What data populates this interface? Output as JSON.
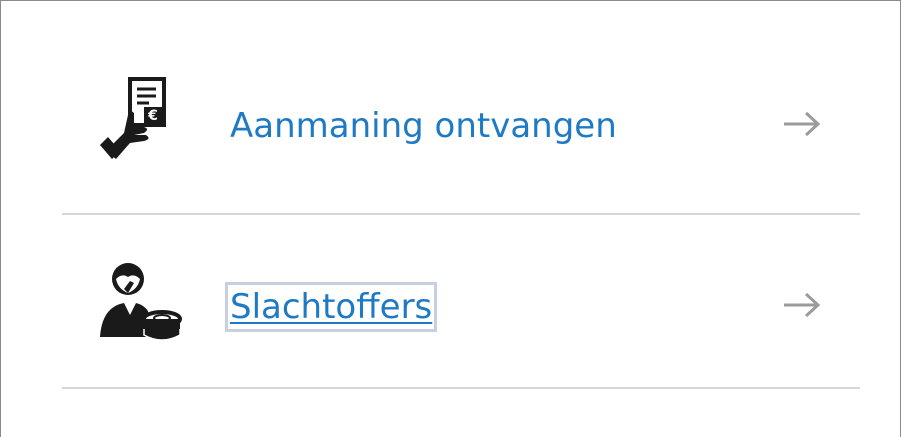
{
  "items": [
    {
      "label": "Aanmaning ontvangen",
      "icon": "hand-holding-euro-bill-icon",
      "arrow_icon": "arrow-right-icon"
    },
    {
      "label": "Slachtoffers",
      "icon": "victim-person-coins-icon",
      "arrow_icon": "arrow-right-icon"
    }
  ],
  "colors": {
    "link": "#1f7ac5",
    "arrow": "#9b9b9b",
    "divider": "#d6d6d6",
    "icon": "#1a1a1a",
    "focus": "#c7cfe0"
  }
}
